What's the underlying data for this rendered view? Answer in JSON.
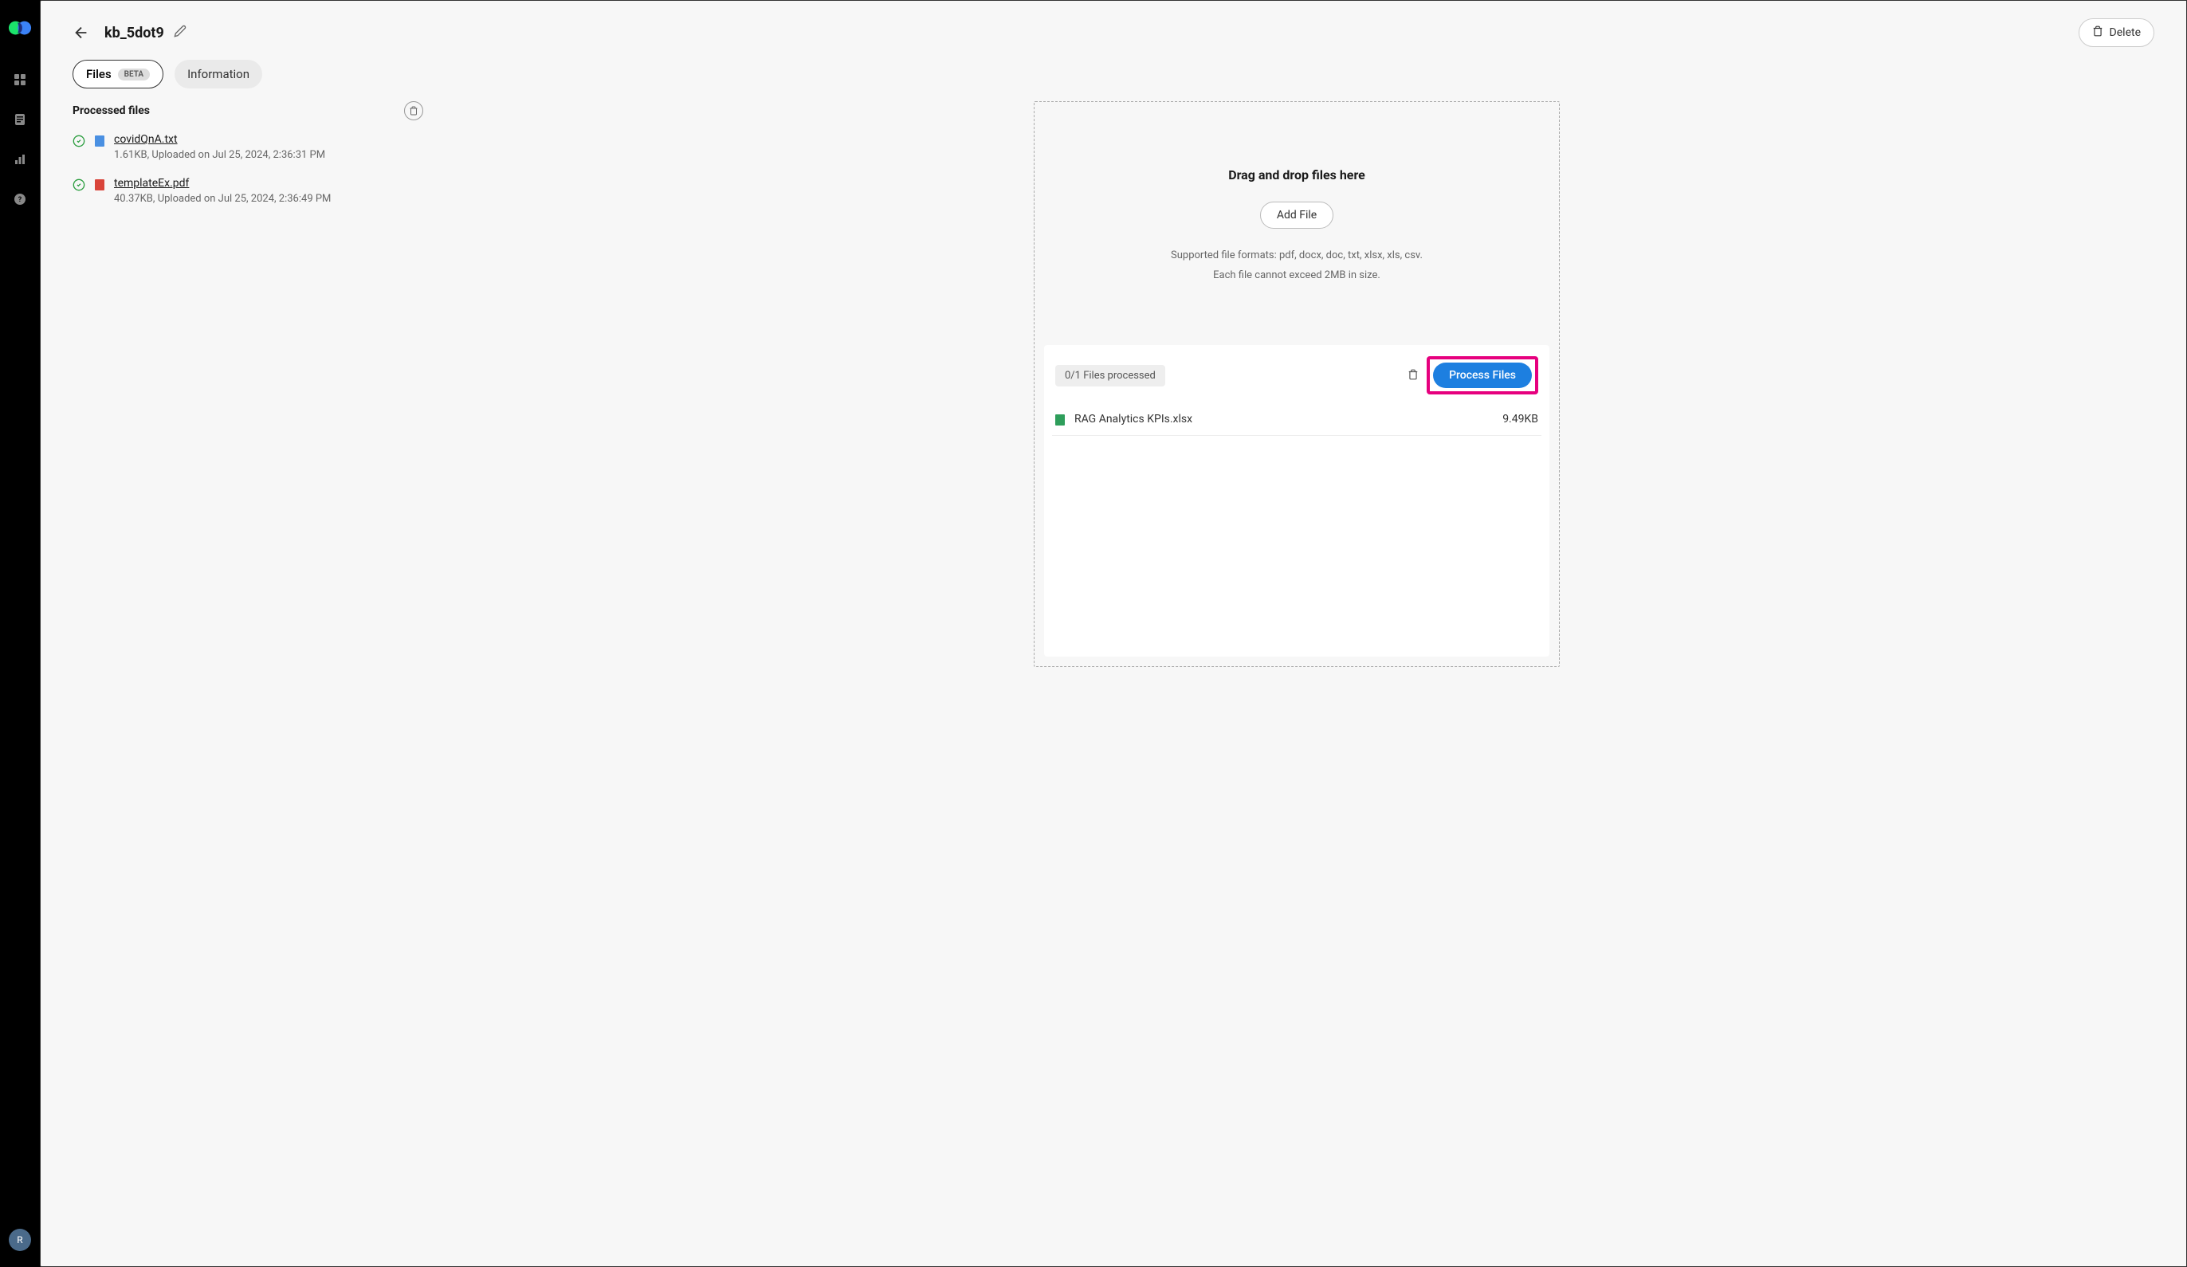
{
  "sidebar": {
    "avatar": "R"
  },
  "header": {
    "title": "kb_5dot9",
    "delete_label": "Delete"
  },
  "tabs": {
    "files_label": "Files",
    "files_badge": "BETA",
    "info_label": "Information"
  },
  "processed": {
    "title": "Processed files",
    "files": [
      {
        "name": "covidQnA.txt",
        "meta": "1.61KB, Uploaded on Jul 25, 2024, 2:36:31 PM",
        "type": "txt"
      },
      {
        "name": "templateEx.pdf",
        "meta": "40.37KB, Uploaded on Jul 25, 2024, 2:36:49 PM",
        "type": "pdf"
      }
    ]
  },
  "dropzone": {
    "title": "Drag and drop files here",
    "add_file_label": "Add File",
    "formats": "Supported file formats: pdf, docx, doc, txt, xlsx, xls, csv.",
    "limit": "Each file cannot exceed 2MB in size."
  },
  "queue": {
    "status": "0/1 Files processed",
    "process_label": "Process Files",
    "files": [
      {
        "name": "RAG Analytics KPIs.xlsx",
        "size": "9.49KB",
        "type": "xlsx"
      }
    ]
  }
}
